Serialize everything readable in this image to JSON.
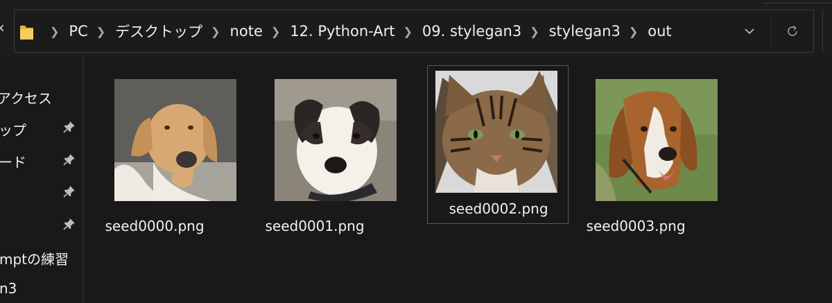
{
  "address_bar": {
    "crumbs": [
      "PC",
      "デスクトップ",
      "note",
      "12. Python-Art",
      "09. stylegan3",
      "stylegan3",
      "out"
    ],
    "icons": {
      "back": "chevron-left-icon",
      "folder": "folder-icon",
      "separator": "chevron-right-icon",
      "dropdown": "chevron-down-icon",
      "refresh": "refresh-icon"
    }
  },
  "nav": {
    "items": [
      {
        "label": "アクセス",
        "pinned": false
      },
      {
        "label": "ップ",
        "pinned": true
      },
      {
        "label": "ード",
        "pinned": true
      },
      {
        "label": "",
        "pinned": true
      },
      {
        "label": "",
        "pinned": true
      },
      {
        "label": "mptの練習",
        "pinned": false
      },
      {
        "label": "n3",
        "pinned": false
      }
    ]
  },
  "files": [
    {
      "name": "seed0000.png",
      "thumbnail": "dog-image",
      "selected": false
    },
    {
      "name": "seed0001.png",
      "thumbnail": "dog-image",
      "selected": false
    },
    {
      "name": "seed0002.png",
      "thumbnail": "cat-image",
      "selected": true
    },
    {
      "name": "seed0003.png",
      "thumbnail": "dog-image",
      "selected": false
    }
  ],
  "colors": {
    "background": "#191919",
    "text": "#f0f0f0",
    "folder": "#f2c94c",
    "selection_border": "#5c5c5c"
  }
}
